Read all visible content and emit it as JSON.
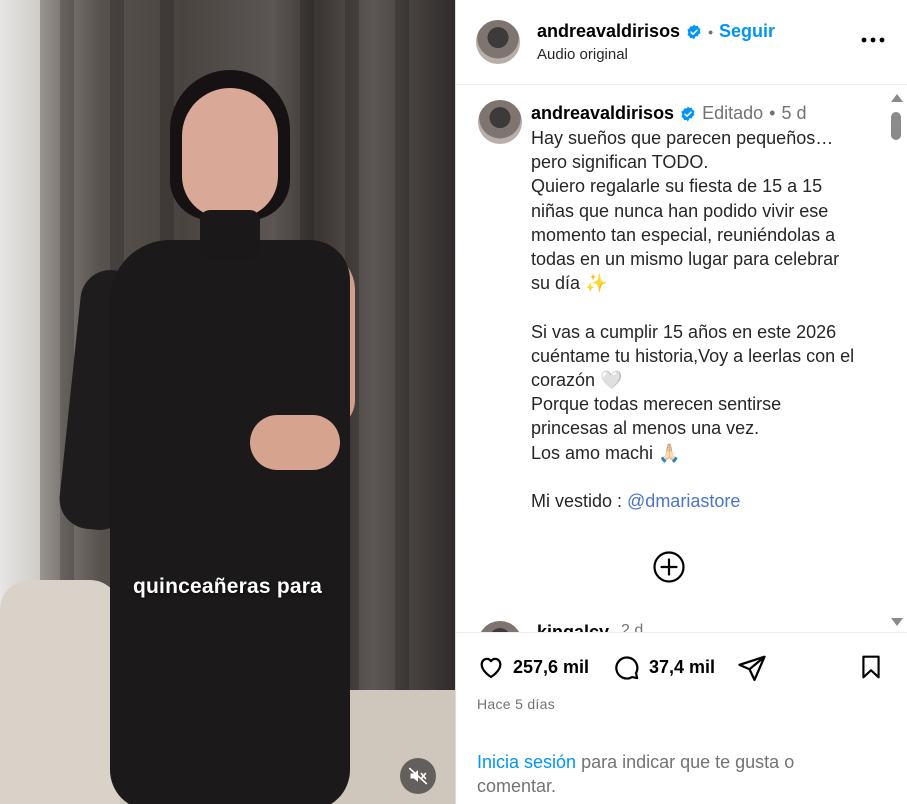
{
  "video": {
    "caption": "quinceañeras para",
    "mute_icon": "speaker-muted-icon"
  },
  "header": {
    "username": "andreavaldirisos",
    "separator": "•",
    "follow_label": "Seguir",
    "audio_label": "Audio original",
    "more_icon": "more-horizontal-icon"
  },
  "post": {
    "username": "andreavaldirisos",
    "edited_label": "Editado",
    "separator": "•",
    "age": "5 d",
    "body": "Hay sueños que parecen pequeños…\npero significan TODO.\nQuiero regalarle su fiesta de 15 a 15 niñas que nunca han podido vivir ese momento tan especial, reuniéndolas a todas en un mismo lugar para celebrar su día ✨\n\nSi vas a cumplir 15 años en este 2026 cuéntame tu historia,Voy a leerlas con el corazón 🤍\nPorque todas merecen sentirse princesas al menos una vez.\nLos amo machi 🙏🏻\n\nMi vestido : ",
    "mention": "@dmariastore",
    "load_more_icon": "plus-circle-icon"
  },
  "next_comment": {
    "username": "kingalcy",
    "age": "2 d"
  },
  "actions": {
    "likes": "257,6 mil",
    "comments": "37,4 mil",
    "time_ago": "Hace 5 días"
  },
  "login_prompt": {
    "link": "Inicia sesión",
    "text": " para indicar que te gusta o comentar."
  },
  "colors": {
    "accent": "#0095f6",
    "verified": "#0095f6",
    "muted_text": "#737373"
  }
}
